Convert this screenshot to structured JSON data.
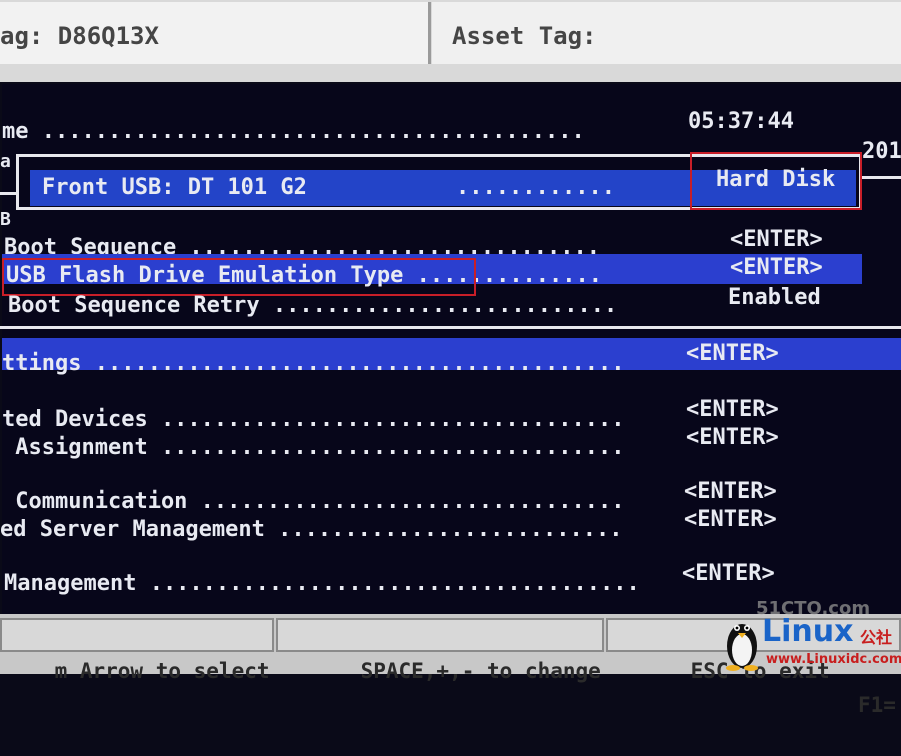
{
  "header": {
    "service_tag": "ag: D86Q13X",
    "asset_tag": "Asset Tag:"
  },
  "rows": {
    "time_label": "me .........................................",
    "time_value": "05:37:44",
    "date_fragment": "201",
    "left_a": "a",
    "left_b": "B",
    "boot_sequence_label": "Boot Sequence ...............................",
    "boot_sequence_value": "<ENTER>",
    "usb_emulation_label": "USB Flash Drive Emulation Type ..............",
    "usb_emulation_value": "<ENTER>",
    "boot_retry_label": "Boot Sequence Retry ..........................",
    "boot_retry_value": "Enabled",
    "settings_label": "ttings ........................................",
    "settings_value": "<ENTER>",
    "integrated_devices_label": "ted Devices ...................................",
    "integrated_devices_value": "<ENTER>",
    "assignment_label": " Assignment ...................................",
    "assignment_value": "<ENTER>",
    "communication_label": " Communication ................................",
    "communication_value": "<ENTER>",
    "server_mgmt_label": "ed Server Management ..........................",
    "server_mgmt_value": "<ENTER>",
    "management_label": "Management .....................................",
    "management_value": "<ENTER>"
  },
  "popup": {
    "device_label": "Front USB: DT 101 G2",
    "dots": "............",
    "device_value": "Hard Disk"
  },
  "help": {
    "arrow": "m Arrow to select",
    "space": "SPACE,+,- to change",
    "esc": "ESC to exit",
    "f1": "F1="
  },
  "watermark": {
    "site_mark": "51CTO.com",
    "brand": "Linux",
    "brand_cn": "公社",
    "url": "www.Linuxidc.com"
  },
  "colors": {
    "background": "#07061a",
    "highlight": "#2b3fcf",
    "text": "#e8eaf2",
    "marker": "#c81e28"
  }
}
